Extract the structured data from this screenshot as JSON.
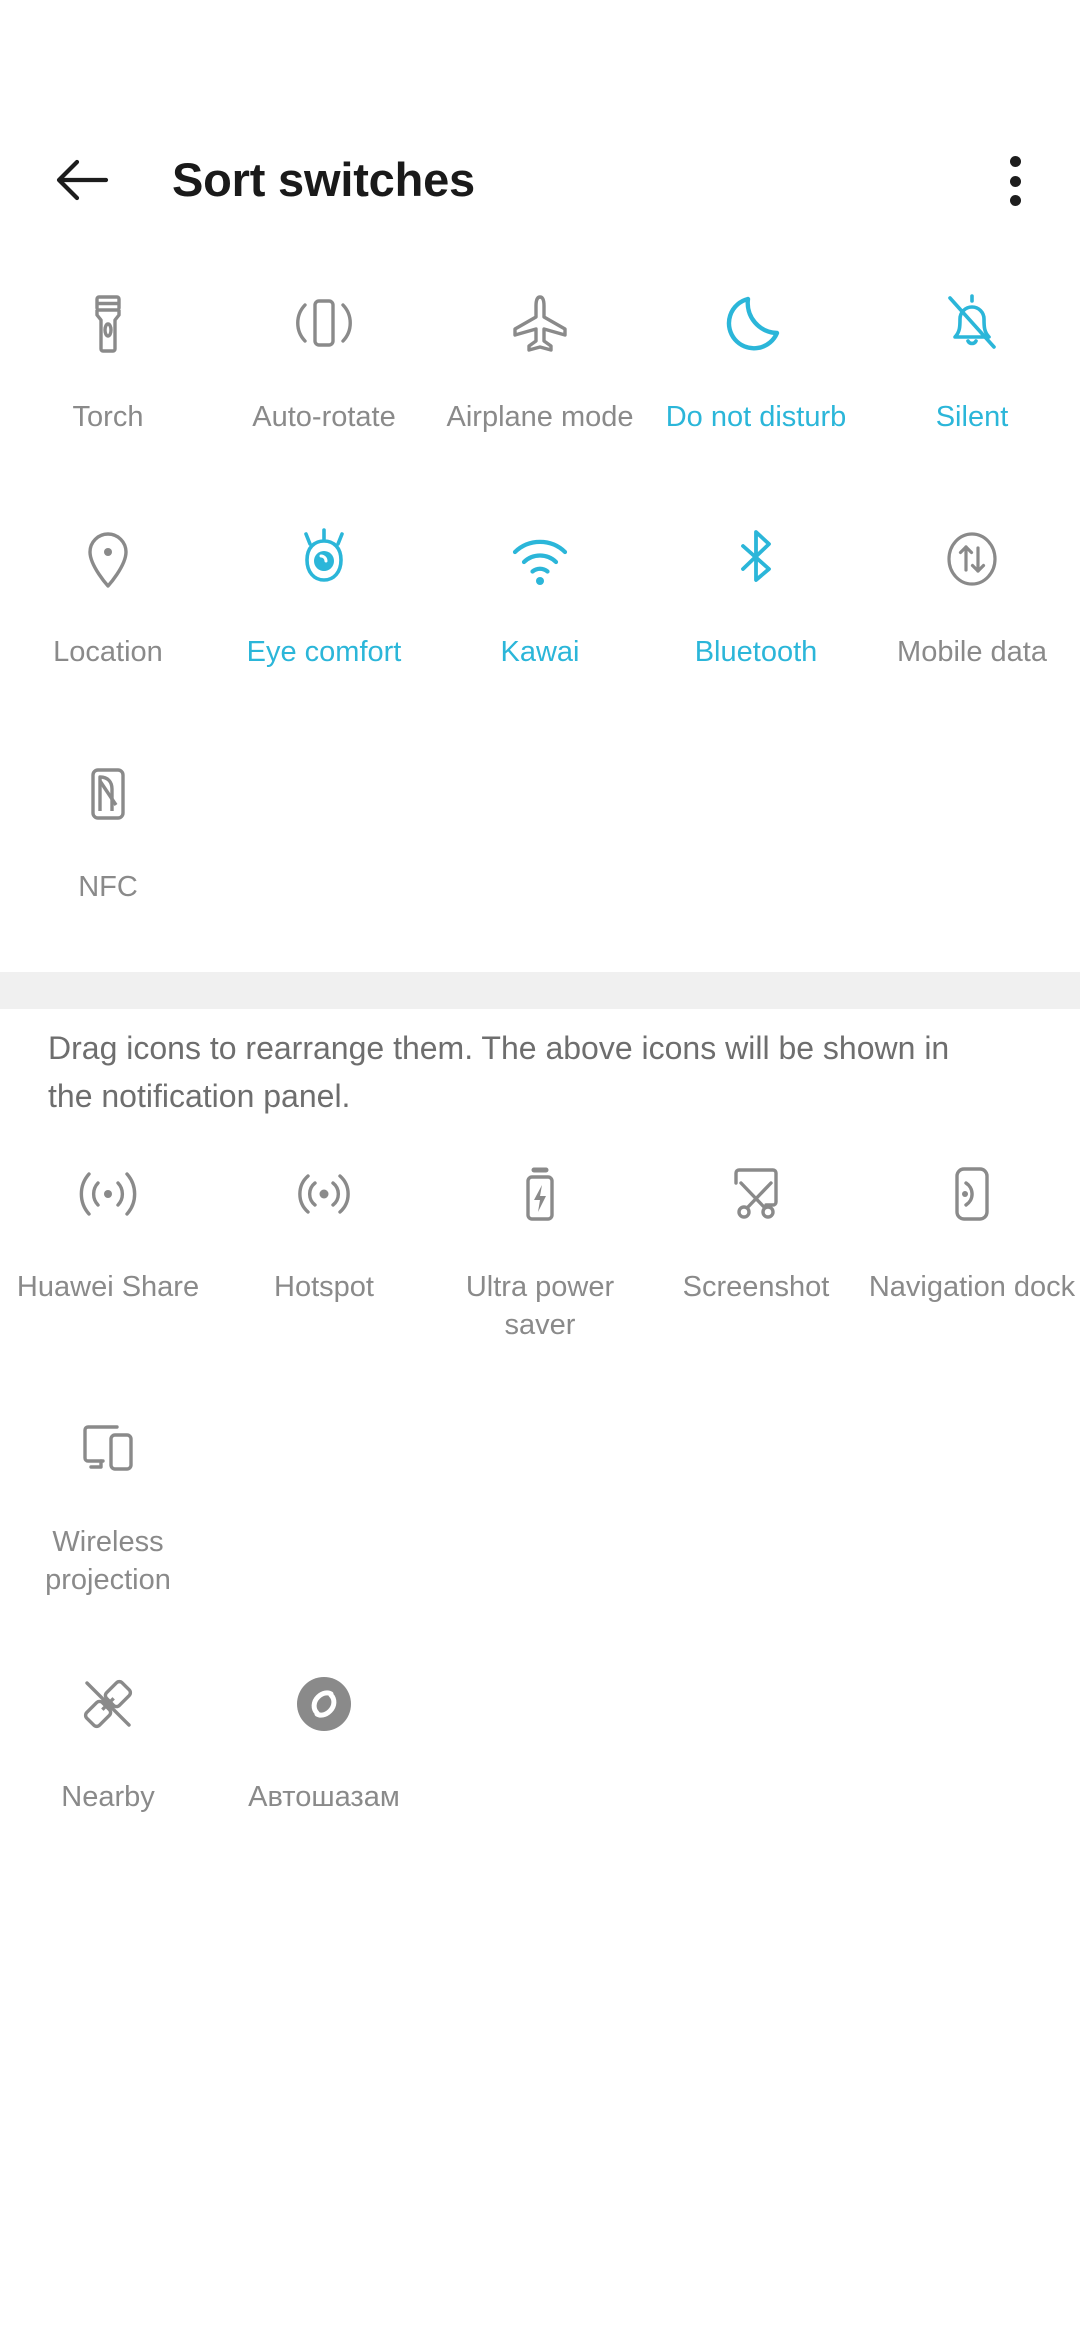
{
  "header": {
    "title": "Sort switches",
    "back_icon": "arrow-left-icon",
    "overflow_icon": "more-vertical-icon"
  },
  "colors": {
    "accent": "#2bb6d9",
    "inactive_label": "#8a8a8a",
    "title": "#1a1a1a",
    "divider_band": "#f0f0f0",
    "hint_text": "#6e6e6e",
    "background": "#ffffff"
  },
  "hint": "Drag icons to rearrange them. The above icons will be shown in the notification panel.",
  "enabled_section": {
    "rows": [
      [
        {
          "label": "Torch",
          "icon": "torch-icon",
          "active": false
        },
        {
          "label": "Auto-rotate",
          "icon": "auto-rotate-icon",
          "active": false
        },
        {
          "label": "Airplane mode",
          "icon": "airplane-icon",
          "active": false
        },
        {
          "label": "Do not disturb",
          "icon": "moon-icon",
          "active": true
        },
        {
          "label": "Silent",
          "icon": "bell-off-icon",
          "active": true
        }
      ],
      [
        {
          "label": "Location",
          "icon": "location-pin-icon",
          "active": false
        },
        {
          "label": "Eye comfort",
          "icon": "eye-comfort-icon",
          "active": true
        },
        {
          "label": "Kawai",
          "icon": "wifi-icon",
          "active": true
        },
        {
          "label": "Bluetooth",
          "icon": "bluetooth-icon",
          "active": true
        },
        {
          "label": "Mobile data",
          "icon": "mobile-data-icon",
          "active": false
        }
      ],
      [
        {
          "label": "NFC",
          "icon": "nfc-icon",
          "active": false
        }
      ]
    ]
  },
  "available_section": {
    "rows": [
      [
        {
          "label": "Huawei Share",
          "icon": "huawei-share-icon",
          "active": false
        },
        {
          "label": "Hotspot",
          "icon": "hotspot-icon",
          "active": false
        },
        {
          "label": "Ultra power saver",
          "icon": "battery-bolt-icon",
          "active": false
        },
        {
          "label": "Screenshot",
          "icon": "scissors-icon",
          "active": false
        },
        {
          "label": "Navigation dock",
          "icon": "navigation-dock-icon",
          "active": false
        }
      ],
      [
        {
          "label": "Wireless projection",
          "icon": "wireless-projection-icon",
          "active": false
        }
      ],
      [
        {
          "label": "Nearby",
          "icon": "nearby-off-icon",
          "active": false
        },
        {
          "label": "Автошазам",
          "icon": "shazam-icon",
          "active": false
        }
      ]
    ]
  }
}
